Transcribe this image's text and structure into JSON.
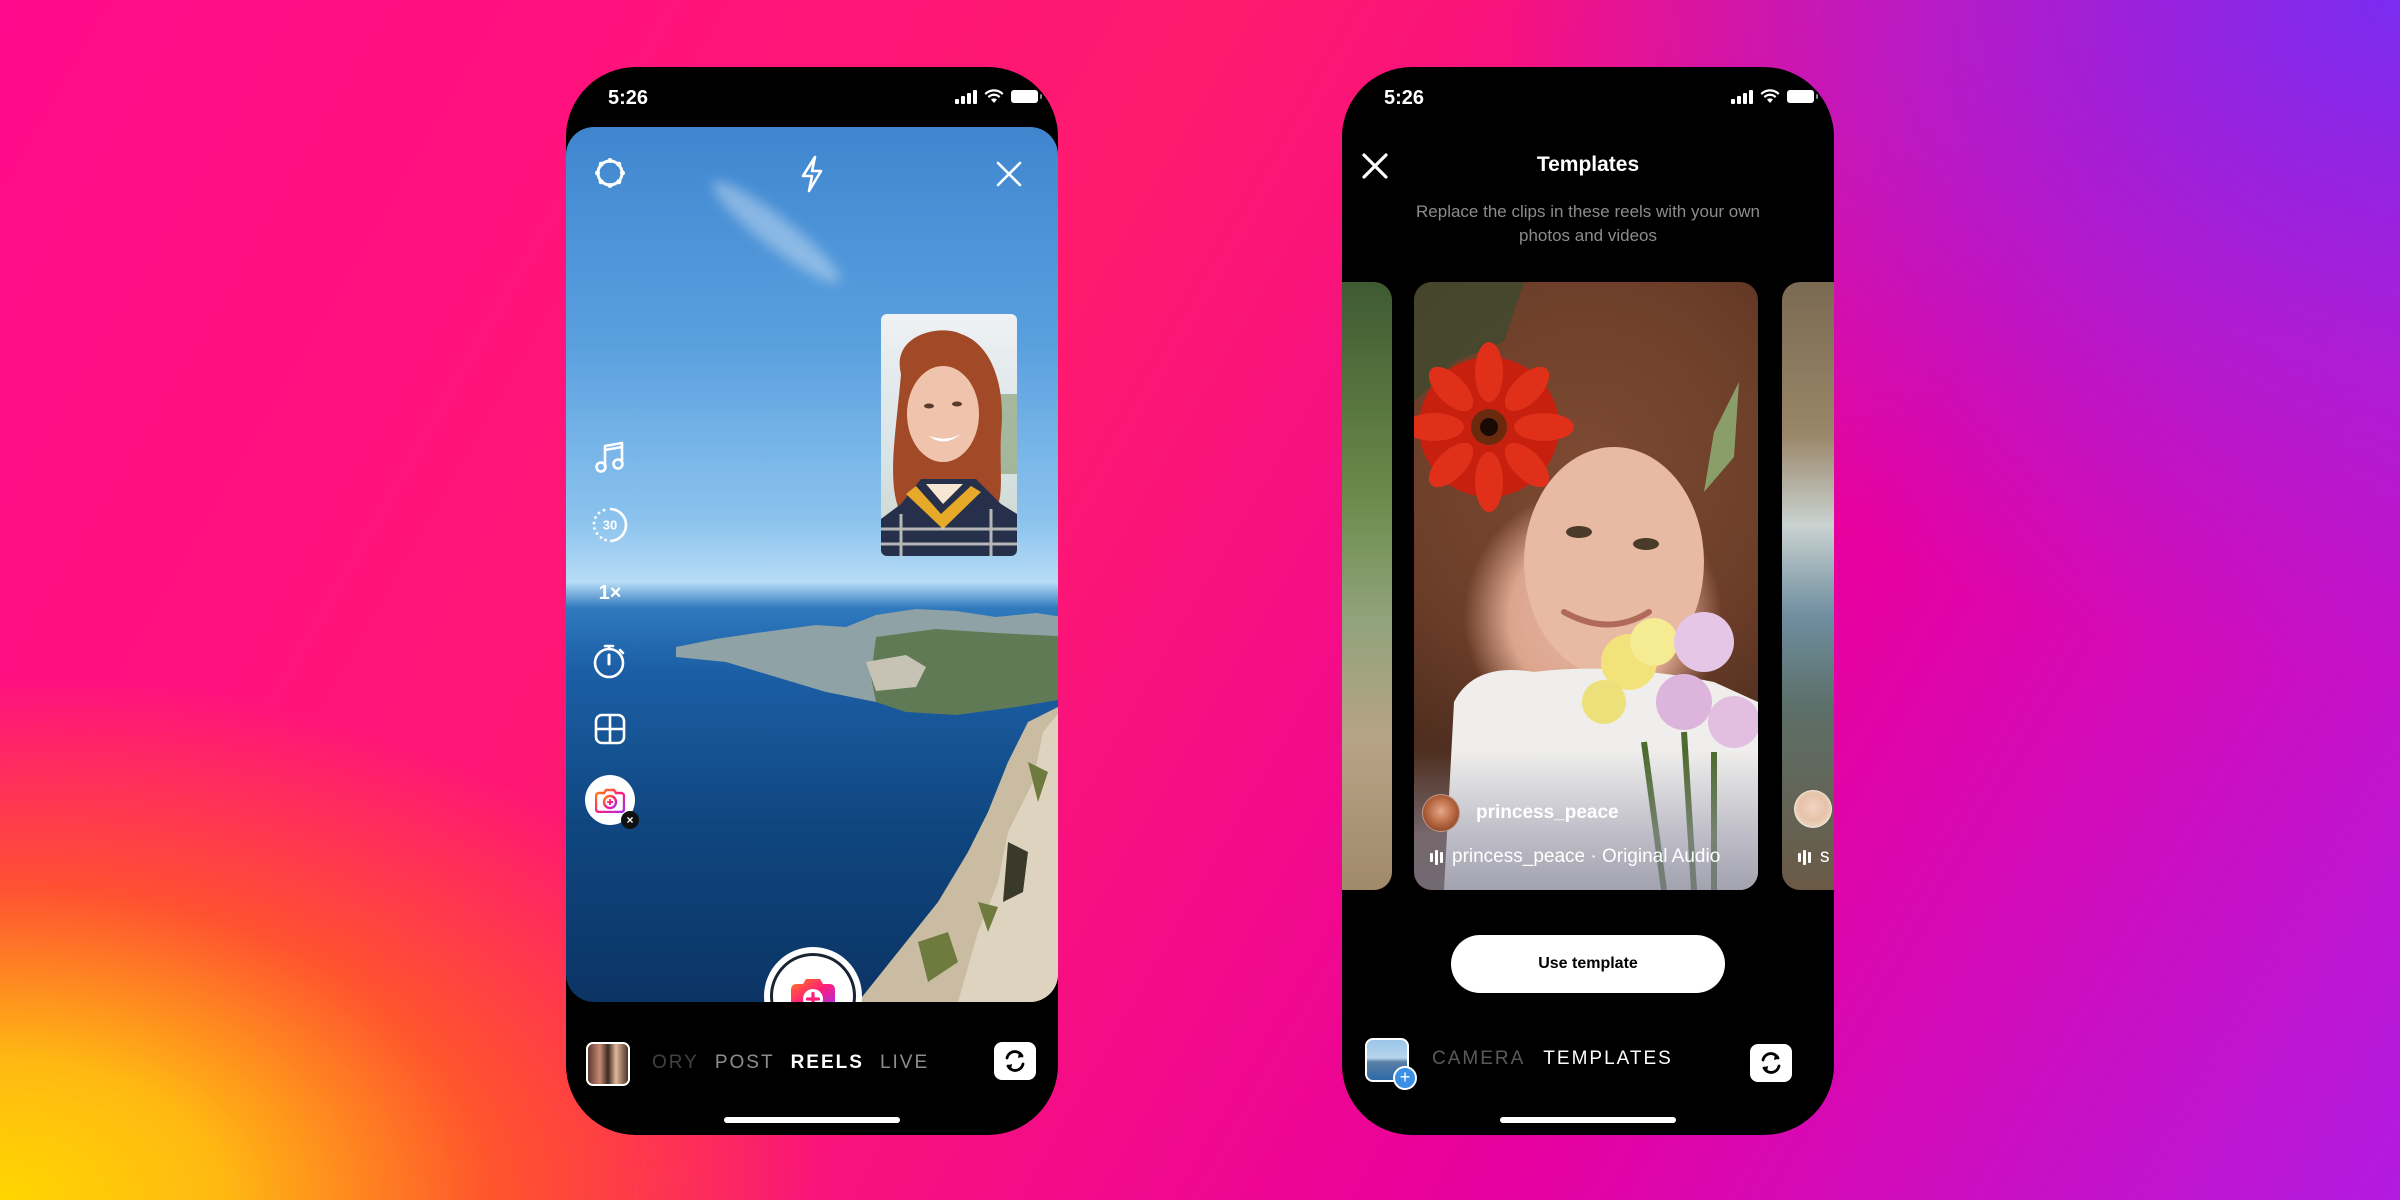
{
  "left_phone": {
    "status": {
      "time": "5:26"
    },
    "top_controls": {
      "settings_icon": "gear-icon",
      "flash_icon": "flash-icon",
      "close_icon": "close-icon"
    },
    "side_tools": [
      {
        "name": "audio",
        "icon": "music-note-icon"
      },
      {
        "name": "length",
        "label": "30",
        "icon": "timer-length-icon"
      },
      {
        "name": "speed",
        "label": "1×"
      },
      {
        "name": "timer",
        "icon": "stopwatch-icon"
      },
      {
        "name": "layout",
        "icon": "layout-grid-icon"
      },
      {
        "name": "dual",
        "icon": "dual-camera-icon",
        "badge": "×"
      }
    ],
    "mode_tabs": [
      {
        "label": "ORY",
        "state": "faded"
      },
      {
        "label": "POST",
        "state": "inactive"
      },
      {
        "label": "REELS",
        "state": "active"
      },
      {
        "label": "LIVE",
        "state": "inactive"
      }
    ],
    "colors": {
      "shutter_gradient": [
        "#ff7a18",
        "#ff1f7a",
        "#a52cf0"
      ]
    }
  },
  "right_phone": {
    "status": {
      "time": "5:26"
    },
    "header": {
      "title": "Templates",
      "subtitle": "Replace the clips in these reels with your own photos and videos"
    },
    "cards": [
      {
        "position": "left-peek"
      },
      {
        "position": "main",
        "author": "princess_peace",
        "audio": "princess_peace · Original Audio"
      },
      {
        "position": "right-peek",
        "audio": "s"
      }
    ],
    "use_template_label": "Use template",
    "mode_tabs": [
      {
        "label": "CAMERA",
        "state": "faded"
      },
      {
        "label": "TEMPLATES",
        "state": "active"
      }
    ],
    "upload_plus": "+"
  }
}
